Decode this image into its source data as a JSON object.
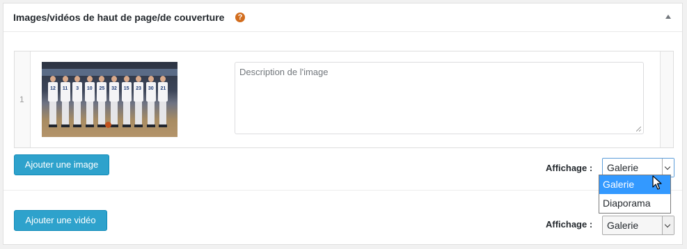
{
  "panel": {
    "title": "Images/vidéos de haut de page/de couverture",
    "help_icon": "question-circle-icon",
    "collapse_icon": "triangle-up-icon"
  },
  "gallery": {
    "rows": [
      {
        "index": "1",
        "image_icon": "team-photo",
        "jersey_numbers": [
          "12",
          "11",
          "3",
          "10",
          "25",
          "32",
          "15",
          "23",
          "30",
          "21"
        ],
        "description_placeholder": "Description de l'image",
        "description_value": ""
      }
    ]
  },
  "actions": {
    "add_image_label": "Ajouter une image",
    "add_video_label": "Ajouter une vidéo"
  },
  "image_display": {
    "label": "Affichage :",
    "selected": "Galerie",
    "dropdown_open": true,
    "options": [
      "Galerie",
      "Diaporama"
    ],
    "highlighted_option": "Galerie"
  },
  "video_display": {
    "label": "Affichage :",
    "selected": "Galerie"
  },
  "colors": {
    "button_bg": "#2ea2cc",
    "help_icon": "#d26d1e",
    "option_highlight": "#3399ff"
  }
}
